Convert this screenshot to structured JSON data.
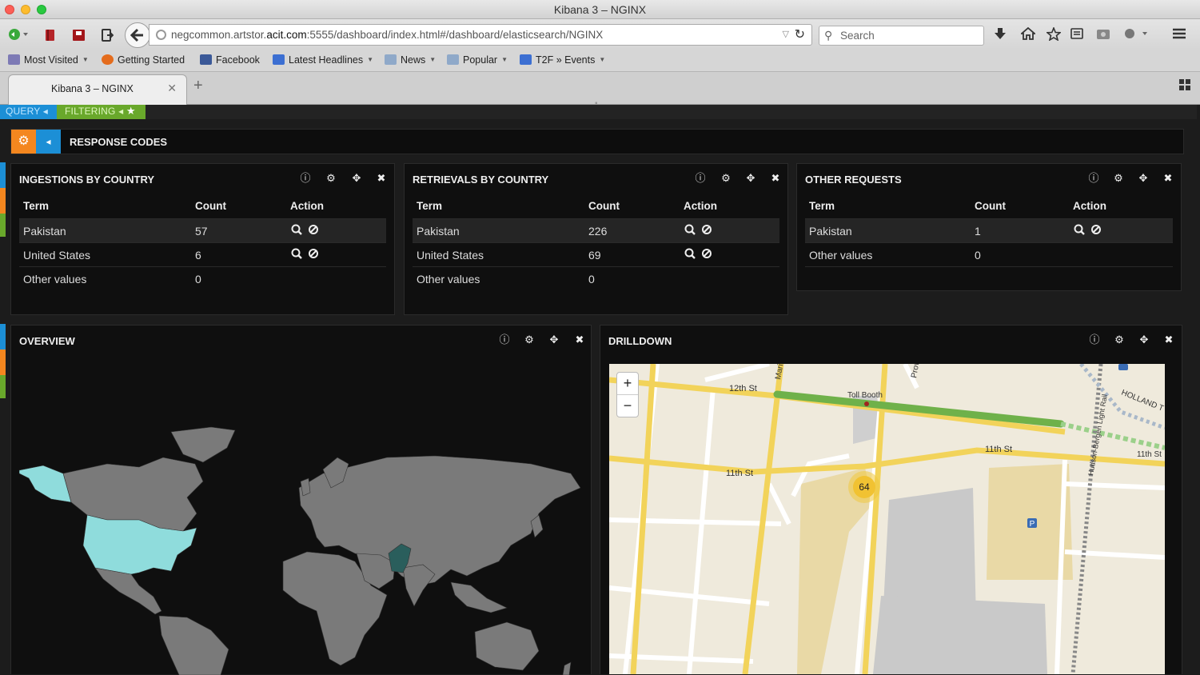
{
  "window": {
    "title": "Kibana 3 – NGINX"
  },
  "navbar": {
    "url_prefix": "negcommon.artstor.",
    "url_host": "acit.com",
    "url_rest": ":5555/dashboard/index.html#/dashboard/elasticsearch/NGINX",
    "search_placeholder": "Search"
  },
  "bookmarks": [
    {
      "label": "Most Visited",
      "icon": "star-folder-icon",
      "caret": true
    },
    {
      "label": "Getting Started",
      "icon": "firefox-icon",
      "caret": false
    },
    {
      "label": "Facebook",
      "icon": "facebook-icon",
      "caret": false
    },
    {
      "label": "Latest Headlines",
      "icon": "rss-icon",
      "caret": true
    },
    {
      "label": "News",
      "icon": "folder-icon",
      "caret": true
    },
    {
      "label": "Popular",
      "icon": "folder-icon",
      "caret": true
    },
    {
      "label": "T2F » Events",
      "icon": "rss-icon",
      "caret": true
    }
  ],
  "tab": {
    "title": "Kibana 3 – NGINX"
  },
  "kibana": {
    "query_tab": "QUERY",
    "filtering_tab": "FILTERING",
    "row_title": "RESPONSE CODES",
    "colors": {
      "query": "#1c8fd6",
      "filtering": "#69a82b",
      "row_gear": "#f4871f"
    },
    "ingestions": {
      "title": "INGESTIONS BY COUNTRY",
      "headers": [
        "Term",
        "Count",
        "Action"
      ],
      "rows": [
        {
          "term": "Pakistan",
          "count": "57"
        },
        {
          "term": "United States",
          "count": "6"
        },
        {
          "term": "Other values",
          "count": "0"
        }
      ]
    },
    "retrievals": {
      "title": "RETRIEVALS BY COUNTRY",
      "headers": [
        "Term",
        "Count",
        "Action"
      ],
      "rows": [
        {
          "term": "Pakistan",
          "count": "226"
        },
        {
          "term": "United States",
          "count": "69"
        },
        {
          "term": "Other values",
          "count": "0"
        }
      ]
    },
    "other": {
      "title": "OTHER REQUESTS",
      "headers": [
        "Term",
        "Count",
        "Action"
      ],
      "rows": [
        {
          "term": "Pakistan",
          "count": "1"
        },
        {
          "term": "Other values",
          "count": "0"
        }
      ]
    },
    "overview": {
      "title": "OVERVIEW"
    },
    "drilldown": {
      "title": "DRILLDOWN",
      "zoom_in": "+",
      "zoom_out": "−",
      "streets": [
        "12th St",
        "11th St",
        "11th St",
        "11th St",
        "HOLLAND T",
        "Marin",
        "Prov",
        "Hudson-Bergen Light Rail"
      ],
      "toll_label": "Toll Booth",
      "cluster_count": "64",
      "parking_label": "P"
    }
  }
}
